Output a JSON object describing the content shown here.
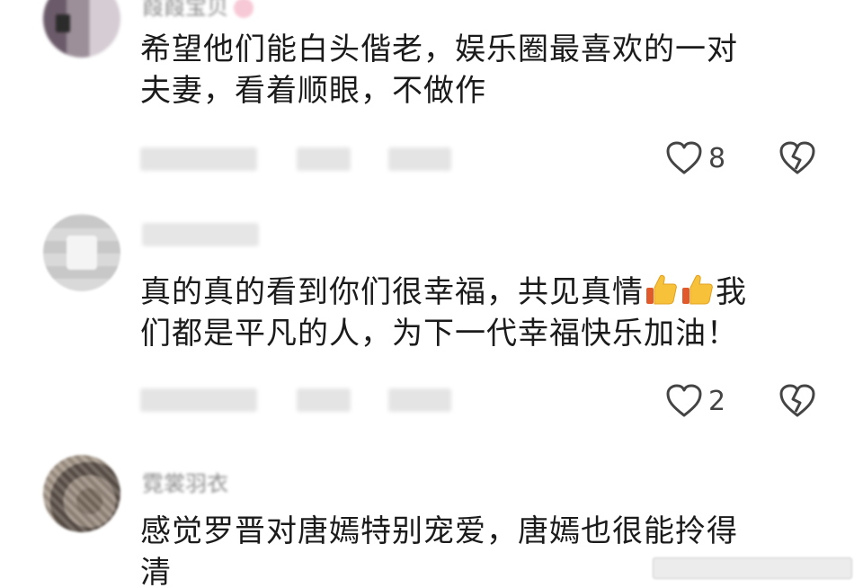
{
  "comments": [
    {
      "username": "葭葭宝贝",
      "text_line1": "希望他们能白头偕老，娱乐圈最喜欢的一对",
      "text_line2": "夫妻，看着顺眼，不做作",
      "likes": "8"
    },
    {
      "username": "",
      "text_line1_a": "真的真的看到你们很幸福，共见真情",
      "text_line1_b": "我",
      "text_line2": "们都是平凡的人，为下一代幸福快乐加油！",
      "likes": "2"
    },
    {
      "username": "霓裳羽衣",
      "text_line1": "感觉罗晋对唐嫣特别宠爱，唐嫣也很能拎得",
      "text_line2": "清"
    }
  ],
  "icons": {
    "like": "heart-outline-icon",
    "dislike": "broken-heart-icon",
    "thumbs": "thumbs-up-emoji"
  },
  "colors": {
    "text": "#1b1b1b",
    "icon": "#444444",
    "meta": "#8a8a8a"
  }
}
